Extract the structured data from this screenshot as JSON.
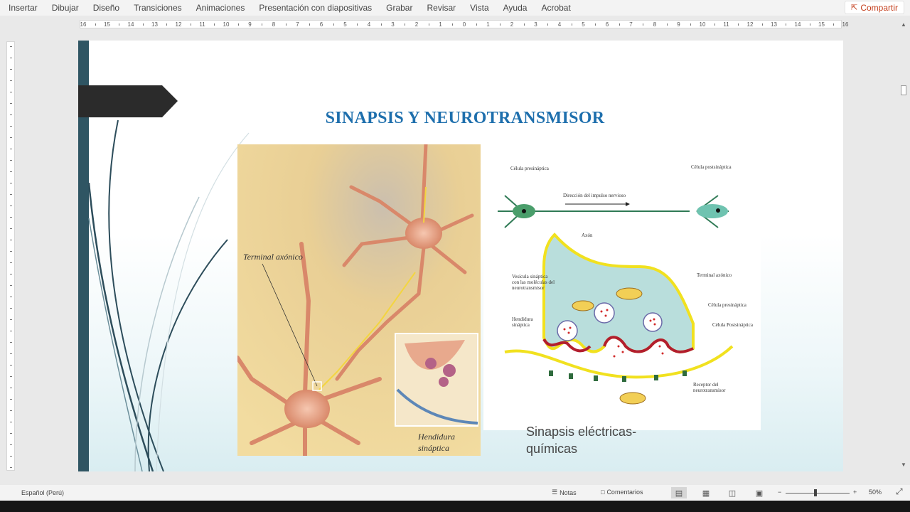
{
  "menu": {
    "items": [
      "Insertar",
      "Dibujar",
      "Diseño",
      "Transiciones",
      "Animaciones",
      "Presentación con diapositivas",
      "Grabar",
      "Revisar",
      "Vista",
      "Ayuda",
      "Acrobat"
    ],
    "share_label": "Compartir"
  },
  "ruler": {
    "labels": [
      "16",
      "15",
      "14",
      "13",
      "12",
      "11",
      "10",
      "9",
      "8",
      "7",
      "6",
      "5",
      "4",
      "3",
      "2",
      "1",
      "0",
      "1",
      "2",
      "3",
      "4",
      "5",
      "6",
      "7",
      "8",
      "9",
      "10",
      "11",
      "12",
      "13",
      "14",
      "15",
      "16"
    ]
  },
  "slide": {
    "title": "SINAPSIS Y NEUROTRANSMISOR",
    "left_image": {
      "label_terminal": "Terminal axónico",
      "label_cleft_1": "Hendidura",
      "label_cleft_2": "sináptica"
    },
    "right_image": {
      "label_pre": "Célula presináptica",
      "label_post": "Célula postsináptica",
      "label_direction": "Dirección del impulso nervioso",
      "label_axon": "Axón",
      "label_terminal": "Terminal axónico",
      "label_vesicles": "Vesícula sináptica con las moléculas del neurotransmisor",
      "label_cleft": "Hendidura sináptica",
      "label_cell_pre": "Célula presináptica",
      "label_cell_post": "Célula Postsináptica",
      "label_receptor": "Receptor del neurotransmisor"
    },
    "caption_line1": "Sinapsis eléctricas-",
    "caption_line2": "químicas"
  },
  "statusbar": {
    "language": "Español (Perú)",
    "notes_label": "Notas",
    "comments_label": "Comentarios",
    "zoom_label": "50%"
  },
  "colors": {
    "title_blue": "#1e6fad",
    "side_bar": "#2f5563",
    "share_red": "#c43e1c"
  }
}
